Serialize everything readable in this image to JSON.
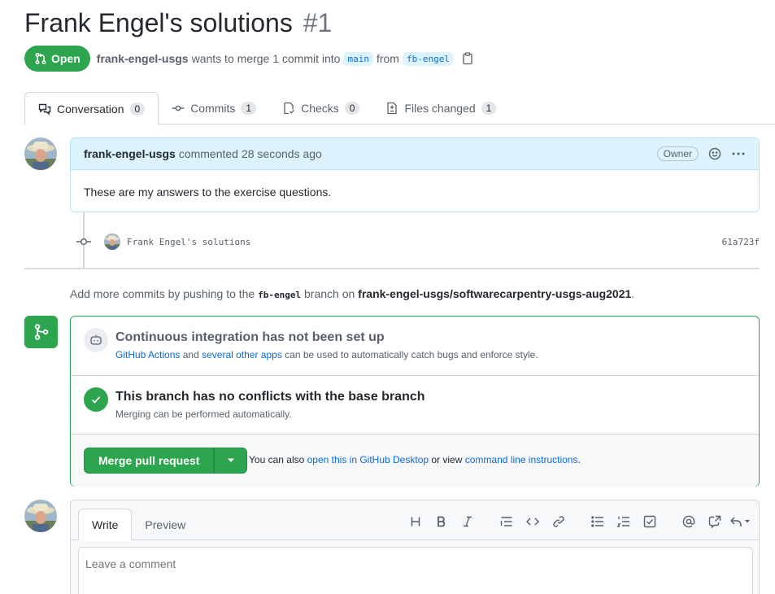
{
  "pr": {
    "title": "Frank Engel's solutions",
    "number": "#1",
    "state": "Open",
    "author": "frank-engel-usgs",
    "merge_text_1": "wants to merge 1 commit into",
    "base_branch": "main",
    "from_text": "from",
    "head_branch": "fb-engel"
  },
  "tabs": [
    {
      "label": "Conversation",
      "count": "0",
      "icon": "comment-discussion-icon"
    },
    {
      "label": "Commits",
      "count": "1",
      "icon": "git-commit-icon"
    },
    {
      "label": "Checks",
      "count": "0",
      "icon": "checklist-icon"
    },
    {
      "label": "Files changed",
      "count": "1",
      "icon": "file-diff-icon"
    }
  ],
  "comment": {
    "author": "frank-engel-usgs",
    "action": "commented",
    "time": "28 seconds ago",
    "badge": "Owner",
    "body": "These are my answers to the exercise questions."
  },
  "commit": {
    "message": "Frank Engel's solutions",
    "sha": "61a723f"
  },
  "push_note": {
    "prefix": "Add more commits by pushing to the",
    "branch": "fb-engel",
    "middle": "branch on",
    "repo": "frank-engel-usgs/softwarecarpentry-usgs-aug2021",
    "suffix": "."
  },
  "ci": {
    "title": "Continuous integration has not been set up",
    "link1": "GitHub Actions",
    "and": "and",
    "link2": "several other apps",
    "rest": "can be used to automatically catch bugs and enforce style."
  },
  "conflicts": {
    "title": "This branch has no conflicts with the base branch",
    "subtitle": "Merging can be performed automatically."
  },
  "merge": {
    "button": "Merge pull request",
    "alt_prefix": "You can also",
    "alt_link1": "open this in GitHub Desktop",
    "alt_mid": "or view",
    "alt_link2": "command line instructions",
    "alt_suffix": "."
  },
  "write": {
    "tab_write": "Write",
    "tab_preview": "Preview",
    "placeholder": "Leave a comment"
  },
  "colors": {
    "accent_green": "#2da44e",
    "link_blue": "#0969da",
    "comment_header": "#ddf4ff"
  }
}
